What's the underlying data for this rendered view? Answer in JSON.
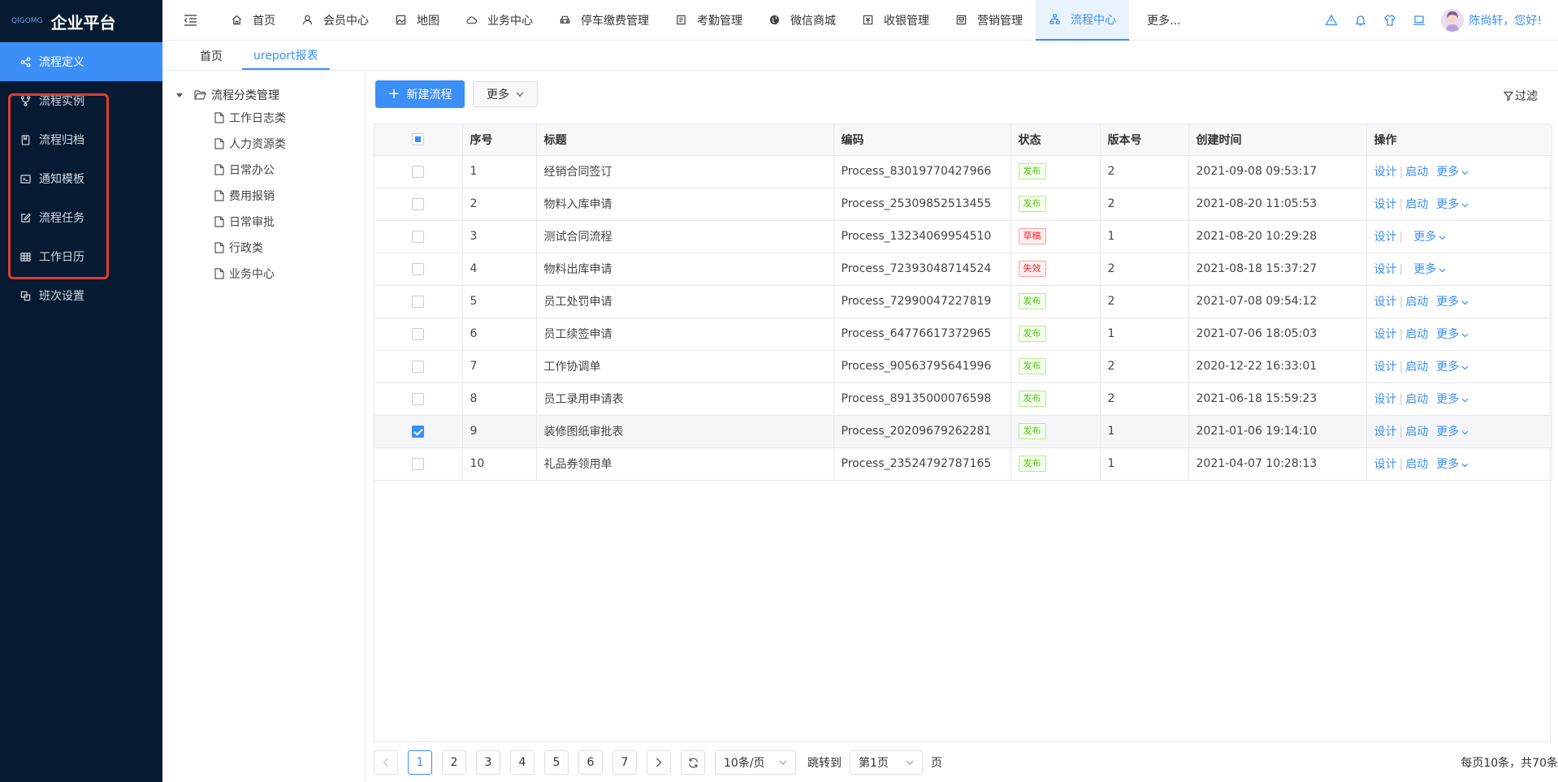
{
  "brand": {
    "logo_text": "QIGOMG",
    "title": "企业平台"
  },
  "sidebar": {
    "items": [
      {
        "label": "流程定义",
        "icon": "share-icon",
        "active": true
      },
      {
        "label": "流程实例",
        "icon": "branch-icon"
      },
      {
        "label": "流程归档",
        "icon": "archive-icon"
      },
      {
        "label": "通知模板",
        "icon": "terminal-icon"
      },
      {
        "label": "流程任务",
        "icon": "edit-icon"
      },
      {
        "label": "工作日历",
        "icon": "calendar-icon"
      },
      {
        "label": "班次设置",
        "icon": "copy-icon"
      }
    ]
  },
  "topnav": {
    "items": [
      {
        "label": "首页",
        "icon": "home-icon"
      },
      {
        "label": "会员中心",
        "icon": "user-icon"
      },
      {
        "label": "地图",
        "icon": "map-icon"
      },
      {
        "label": "业务中心",
        "icon": "cloud-icon"
      },
      {
        "label": "停车缴费管理",
        "icon": "car-icon"
      },
      {
        "label": "考勤管理",
        "icon": "attendance-icon"
      },
      {
        "label": "微信商城",
        "icon": "globe-icon"
      },
      {
        "label": "收银管理",
        "icon": "cashier-icon"
      },
      {
        "label": "营销管理",
        "icon": "marketing-icon"
      },
      {
        "label": "流程中心",
        "icon": "flow-icon",
        "active": true
      }
    ],
    "more": "更多...",
    "user": "陈尚轩，您好!"
  },
  "tabs": [
    "首页",
    "ureport报表"
  ],
  "tree": {
    "root": "流程分类管理",
    "children": [
      "工作日志类",
      "人力资源类",
      "日常办公",
      "费用报销",
      "日常审批",
      "行政类",
      "业务中心"
    ]
  },
  "toolbar": {
    "new_label": "新建流程",
    "more_label": "更多",
    "filter_label": "过滤"
  },
  "table": {
    "headers": [
      "序号",
      "标题",
      "编码",
      "状态",
      "版本号",
      "创建时间",
      "操作"
    ],
    "rows": [
      {
        "no": "1",
        "title": "经销合同签订",
        "code": "Process_83019770427966",
        "status": "发布",
        "kind": "pub",
        "version": "2",
        "time": "2021-09-08 09:53:17",
        "start": true
      },
      {
        "no": "2",
        "title": "物料入库申请",
        "code": "Process_25309852513455",
        "status": "发布",
        "kind": "pub",
        "version": "2",
        "time": "2021-08-20 11:05:53",
        "start": true
      },
      {
        "no": "3",
        "title": "测试合同流程",
        "code": "Process_13234069954510",
        "status": "草稿",
        "kind": "draft",
        "version": "1",
        "time": "2021-08-20 10:29:28",
        "start": false
      },
      {
        "no": "4",
        "title": "物料出库申请",
        "code": "Process_72393048714524",
        "status": "失效",
        "kind": "inv",
        "version": "2",
        "time": "2021-08-18 15:37:27",
        "start": false
      },
      {
        "no": "5",
        "title": "员工处罚申请",
        "code": "Process_72990047227819",
        "status": "发布",
        "kind": "pub",
        "version": "2",
        "time": "2021-07-08 09:54:12",
        "start": true
      },
      {
        "no": "6",
        "title": "员工续签申请",
        "code": "Process_64776617372965",
        "status": "发布",
        "kind": "pub",
        "version": "1",
        "time": "2021-07-06 18:05:03",
        "start": true
      },
      {
        "no": "7",
        "title": "工作协调单",
        "code": "Process_90563795641996",
        "status": "发布",
        "kind": "pub",
        "version": "2",
        "time": "2020-12-22 16:33:01",
        "start": true
      },
      {
        "no": "8",
        "title": "员工录用申请表",
        "code": "Process_89135000076598",
        "status": "发布",
        "kind": "pub",
        "version": "2",
        "time": "2021-06-18 15:59:23",
        "start": true
      },
      {
        "no": "9",
        "title": "装修图纸审批表",
        "code": "Process_20209679262281",
        "status": "发布",
        "kind": "pub",
        "version": "1",
        "time": "2021-01-06 19:14:10",
        "start": true,
        "checked": true
      },
      {
        "no": "10",
        "title": "礼品券领用单",
        "code": "Process_23524792787165",
        "status": "发布",
        "kind": "pub",
        "version": "1",
        "time": "2021-04-07 10:28:13",
        "start": true
      }
    ],
    "op_design": "设计",
    "op_start": "启动",
    "op_more": "更多"
  },
  "pager": {
    "pages": [
      "1",
      "2",
      "3",
      "4",
      "5",
      "6",
      "7"
    ],
    "current": "1",
    "page_size": "10条/页",
    "goto_label": "跳转到",
    "goto_value": "第1页",
    "page_unit": "页",
    "total": "每页10条，共70条"
  },
  "colors": {
    "accent": "#3b8ff6",
    "sidebar_bg": "#061a31",
    "highlight": "#e23a32"
  }
}
